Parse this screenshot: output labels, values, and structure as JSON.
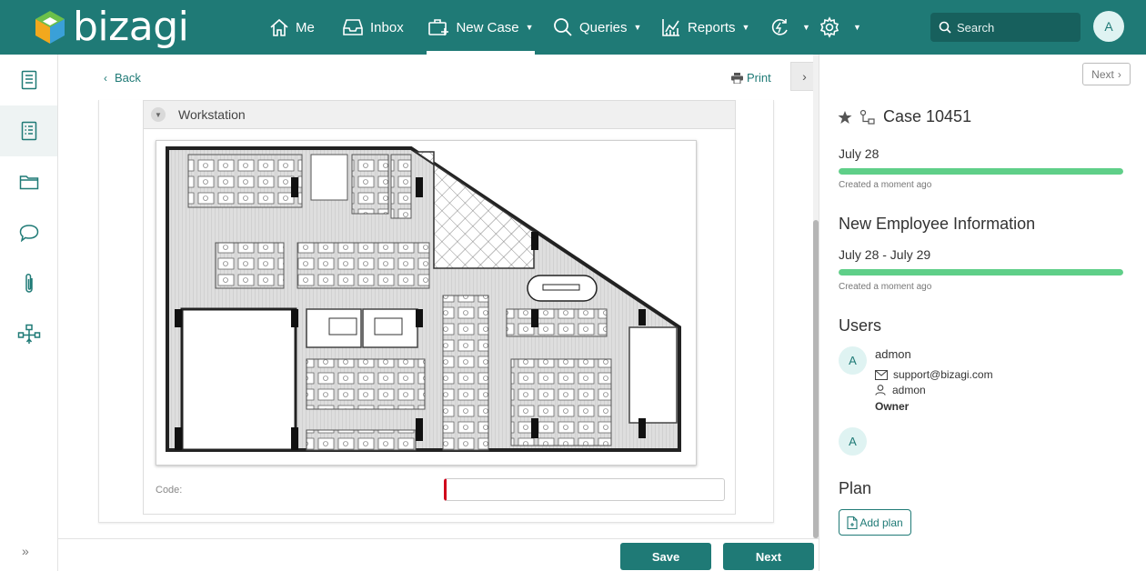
{
  "app": {
    "logo_text": "bizagi"
  },
  "nav": {
    "me": "Me",
    "inbox": "Inbox",
    "new_case": "New Case",
    "queries": "Queries",
    "reports": "Reports",
    "search_placeholder": "Search",
    "user_initial": "A"
  },
  "toolbar": {
    "back": "Back",
    "print": "Print"
  },
  "form": {
    "section_title": "Workstation",
    "code_label": "Code:",
    "code_value": ""
  },
  "case": {
    "next_label": "Next",
    "title": "Case 10451",
    "case_date": "July 28",
    "case_progress": 1.0,
    "case_created": "Created a moment ago",
    "task_title": "New Employee Information",
    "task_dates": "July 28 - July 29",
    "task_progress": 1.0,
    "task_created": "Created a moment ago"
  },
  "users": {
    "title": "Users",
    "items": [
      {
        "initial": "A",
        "name": "admon",
        "email": "support@bizagi.com",
        "login": "admon",
        "role": "Owner"
      },
      {
        "initial": "A"
      }
    ]
  },
  "plan": {
    "title": "Plan",
    "add_label": "Add plan"
  },
  "footer": {
    "save": "Save",
    "next": "Next"
  },
  "colors": {
    "brand": "#1f7a76",
    "progress": "#5fcf88",
    "required": "#d0021b"
  }
}
